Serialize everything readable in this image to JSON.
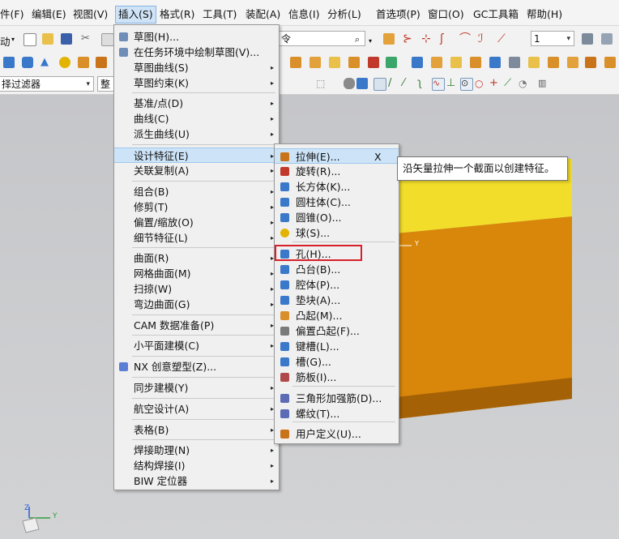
{
  "menubar": {
    "items": [
      "件(F)",
      "编辑(E)",
      "视图(V)",
      "插入(S)",
      "格式(R)",
      "工具(T)",
      "装配(A)",
      "信息(I)",
      "分析(L)",
      "首选项(P)",
      "窗口(O)",
      "GC工具箱",
      "帮助(H)"
    ],
    "active_index": 3
  },
  "toolbar": {
    "start_label": "动",
    "command_field": "令",
    "layer_value": "1",
    "selection_filter": "择过滤器",
    "scope_value": "整"
  },
  "insert_menu": {
    "items": [
      {
        "label": "草图(H)...",
        "icon": "sketch-icon",
        "submenu": false
      },
      {
        "label": "在任务环境中绘制草图(V)...",
        "icon": "sketch-task-icon",
        "submenu": false
      },
      {
        "label": "草图曲线(S)",
        "icon": "",
        "submenu": true
      },
      {
        "label": "草图约束(K)",
        "icon": "",
        "submenu": true
      },
      {
        "label": "基准/点(D)",
        "icon": "",
        "submenu": true
      },
      {
        "label": "曲线(C)",
        "icon": "",
        "submenu": true
      },
      {
        "label": "派生曲线(U)",
        "icon": "",
        "submenu": true
      },
      {
        "label": "设计特征(E)",
        "icon": "",
        "submenu": true
      },
      {
        "label": "关联复制(A)",
        "icon": "",
        "submenu": true
      },
      {
        "label": "组合(B)",
        "icon": "",
        "submenu": true
      },
      {
        "label": "修剪(T)",
        "icon": "",
        "submenu": true
      },
      {
        "label": "偏置/缩放(O)",
        "icon": "",
        "submenu": true
      },
      {
        "label": "细节特征(L)",
        "icon": "",
        "submenu": true
      },
      {
        "label": "曲面(R)",
        "icon": "",
        "submenu": true
      },
      {
        "label": "网格曲面(M)",
        "icon": "",
        "submenu": true
      },
      {
        "label": "扫掠(W)",
        "icon": "",
        "submenu": true
      },
      {
        "label": "弯边曲面(G)",
        "icon": "",
        "submenu": true
      },
      {
        "label": "CAM 数据准备(P)",
        "icon": "",
        "submenu": true
      },
      {
        "label": "小平面建模(C)",
        "icon": "",
        "submenu": true
      },
      {
        "label": "NX 创意塑型(Z)...",
        "icon": "nx-realize-shape-icon",
        "submenu": false
      },
      {
        "label": "同步建模(Y)",
        "icon": "",
        "submenu": true
      },
      {
        "label": "航空设计(A)",
        "icon": "",
        "submenu": true
      },
      {
        "label": "表格(B)",
        "icon": "",
        "submenu": true
      },
      {
        "label": "焊接助理(N)",
        "icon": "",
        "submenu": true
      },
      {
        "label": "结构焊接(I)",
        "icon": "",
        "submenu": true
      },
      {
        "label": "BIW 定位器",
        "icon": "",
        "submenu": true
      }
    ]
  },
  "design_feature_menu": {
    "items": [
      {
        "label": "拉伸(E)...",
        "shortcut": "X",
        "icon": "extrude-icon",
        "color": "#c9741a"
      },
      {
        "label": "旋转(R)...",
        "shortcut": "",
        "icon": "revolve-icon",
        "color": "#c0392b"
      },
      {
        "label": "长方体(K)...",
        "shortcut": "",
        "icon": "block-icon",
        "color": "#3a78c9"
      },
      {
        "label": "圆柱体(C)...",
        "shortcut": "",
        "icon": "cylinder-icon",
        "color": "#3a78c9"
      },
      {
        "label": "圆锥(O)...",
        "shortcut": "",
        "icon": "cone-icon",
        "color": "#3a78c9"
      },
      {
        "label": "球(S)...",
        "shortcut": "",
        "icon": "sphere-icon",
        "color": "#e2b400"
      },
      {
        "label": "孔(H)...",
        "shortcut": "",
        "icon": "hole-icon",
        "color": "#3a78c9"
      },
      {
        "label": "凸台(B)...",
        "shortcut": "",
        "icon": "boss-icon",
        "color": "#3a78c9"
      },
      {
        "label": "腔体(P)...",
        "shortcut": "",
        "icon": "pocket-icon",
        "color": "#3a78c9"
      },
      {
        "label": "垫块(A)...",
        "shortcut": "",
        "icon": "pad-icon",
        "color": "#3a78c9"
      },
      {
        "label": "凸起(M)...",
        "shortcut": "",
        "icon": "emboss-icon",
        "color": "#d9902a"
      },
      {
        "label": "偏置凸起(F)...",
        "shortcut": "",
        "icon": "offset-emboss-icon",
        "color": "#7a7a7a"
      },
      {
        "label": "键槽(L)...",
        "shortcut": "",
        "icon": "slot-icon",
        "color": "#3a78c9"
      },
      {
        "label": "槽(G)...",
        "shortcut": "",
        "icon": "groove-icon",
        "color": "#3a78c9"
      },
      {
        "label": "筋板(I)...",
        "shortcut": "",
        "icon": "rib-icon",
        "color": "#b04a4a"
      },
      {
        "label": "三角形加强筋(D)...",
        "shortcut": "",
        "icon": "dart-icon",
        "color": "#5b6bb5"
      },
      {
        "label": "螺纹(T)...",
        "shortcut": "",
        "icon": "thread-icon",
        "color": "#5b6bb5"
      },
      {
        "label": "用户定义(U)...",
        "shortcut": "",
        "icon": "user-defined-icon",
        "color": "#c9741a"
      }
    ]
  },
  "tooltip": "沿矢量拉伸一个截面以创建特征。",
  "canvas": {
    "axis_label_y": "Y",
    "triad_z": "Z",
    "triad_y": "Y",
    "box_top_color": "#f2dd2a",
    "box_front_color": "#d9870a",
    "box_bottom_color": "#9a5a06"
  }
}
